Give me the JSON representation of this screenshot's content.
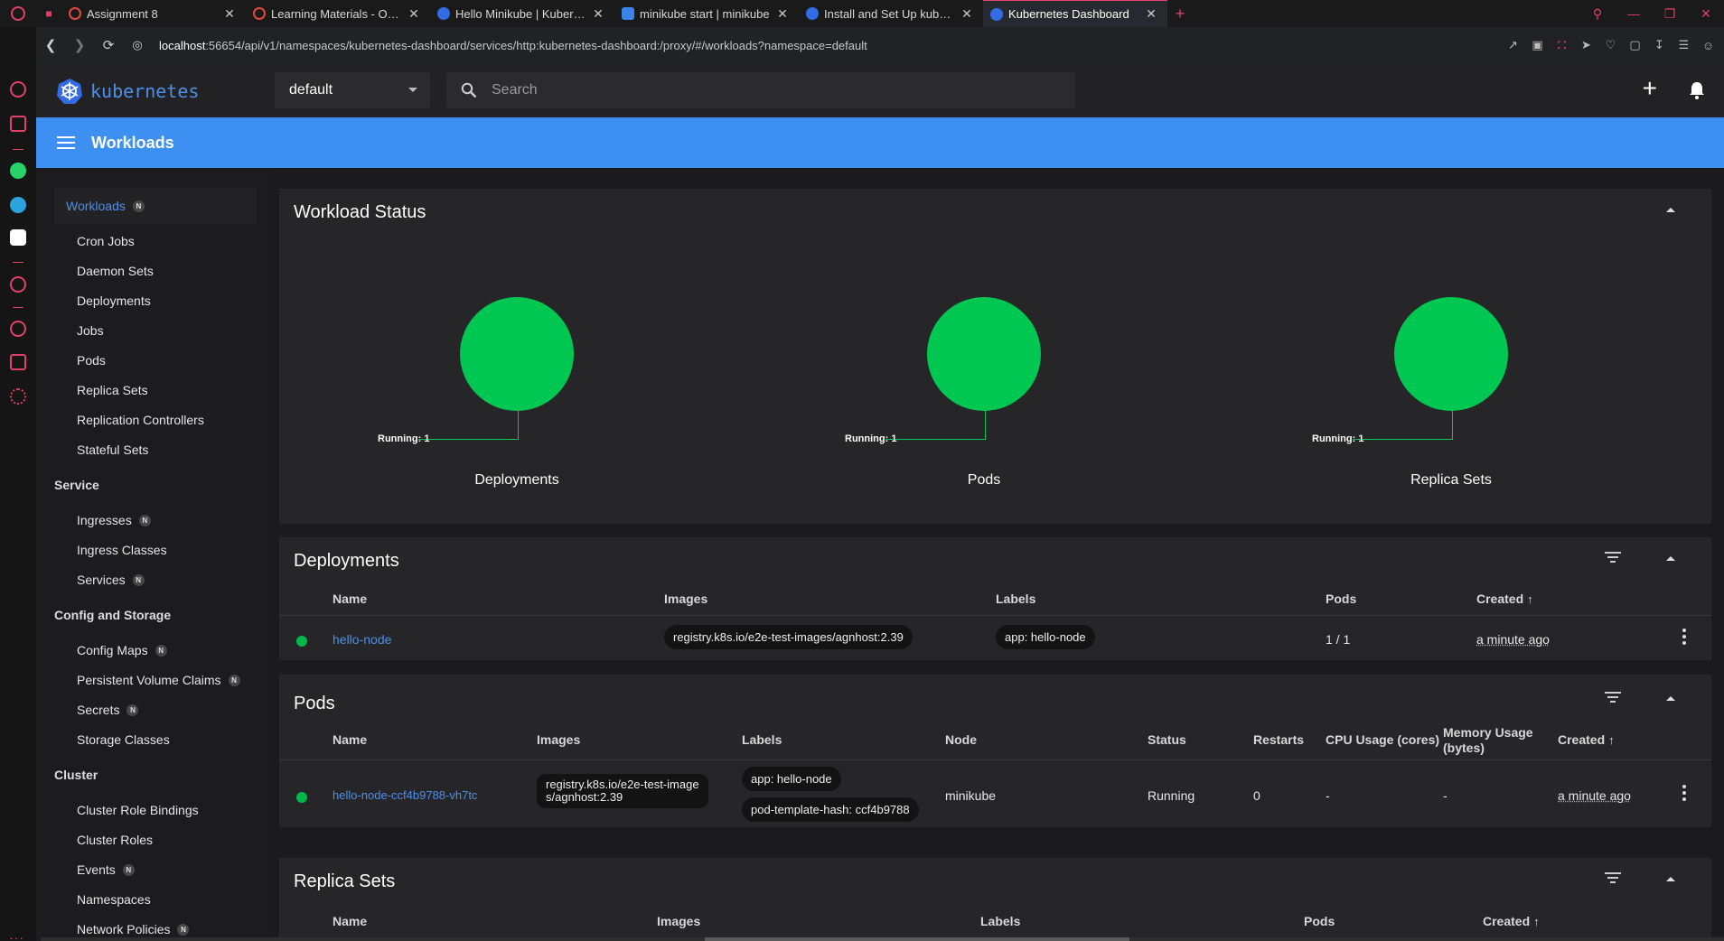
{
  "browser": {
    "tabs": [
      {
        "label": "",
        "favicon": "discord-icon",
        "color": "#e0406a"
      },
      {
        "label": "Assignment 8",
        "favicon": "red-ring",
        "color": "#e34b3b"
      },
      {
        "label": "Learning Materials - Opera",
        "favicon": "red-ring",
        "color": "#e34b3b"
      },
      {
        "label": "Hello Minikube | Kubernetes",
        "favicon": "k8s",
        "color": "#326ce5"
      },
      {
        "label": "minikube start | minikube",
        "favicon": "cube",
        "color": "#3a86e8"
      },
      {
        "label": "Install and Set Up kubectl on",
        "favicon": "k8s",
        "color": "#326ce5"
      },
      {
        "label": "Kubernetes Dashboard",
        "favicon": "k8s",
        "color": "#326ce5"
      }
    ],
    "url_host": "localhost",
    "url_rest": ":56654/api/v1/namespaces/kubernetes-dashboard/services/http:kubernetes-dashboard:/proxy/#/workloads?namespace=default"
  },
  "header": {
    "brand": "kubernetes",
    "namespace": "default",
    "search_placeholder": "Search"
  },
  "toolbar": {
    "title": "Workloads"
  },
  "nav": {
    "workloads": "Workloads",
    "workload_items": [
      "Cron Jobs",
      "Daemon Sets",
      "Deployments",
      "Jobs",
      "Pods",
      "Replica Sets",
      "Replication Controllers",
      "Stateful Sets"
    ],
    "service": "Service",
    "service_items": [
      "Ingresses",
      "Ingress Classes",
      "Services"
    ],
    "config": "Config and Storage",
    "config_items": [
      "Config Maps",
      "Persistent Volume Claims",
      "Secrets",
      "Storage Classes"
    ],
    "cluster": "Cluster",
    "cluster_items": [
      "Cluster Role Bindings",
      "Cluster Roles",
      "Events",
      "Namespaces",
      "Network Policies"
    ],
    "badge": "N"
  },
  "workload_status": {
    "title": "Workload Status",
    "cells": [
      {
        "name": "Deployments",
        "running_label": "Running: 1",
        "running": 1
      },
      {
        "name": "Pods",
        "running_label": "Running: 1",
        "running": 1
      },
      {
        "name": "Replica Sets",
        "running_label": "Running: 1",
        "running": 1
      }
    ],
    "running_color": "#00c752"
  },
  "deployments": {
    "title": "Deployments",
    "columns": [
      "Name",
      "Images",
      "Labels",
      "Pods",
      "Created"
    ],
    "row": {
      "name": "hello-node",
      "image": "registry.k8s.io/e2e-test-images/agnhost:2.39",
      "label": "app: hello-node",
      "pods": "1 / 1",
      "created": "a minute ago"
    }
  },
  "pods": {
    "title": "Pods",
    "columns": [
      "Name",
      "Images",
      "Labels",
      "Node",
      "Status",
      "Restarts",
      "CPU Usage (cores)",
      "Memory Usage",
      "(bytes)",
      "Created"
    ],
    "row": {
      "name": "hello-node-ccf4b9788-vh7tc",
      "image_line1": "registry.k8s.io/e2e-test-image",
      "image_line2": "s/agnhost:2.39",
      "label1": "app: hello-node",
      "label2": "pod-template-hash: ccf4b9788",
      "node": "minikube",
      "status": "Running",
      "restarts": "0",
      "cpu": "-",
      "memory": "-",
      "created": "a minute ago"
    }
  },
  "replica_sets": {
    "title": "Replica Sets",
    "columns": [
      "Name",
      "Images",
      "Labels",
      "Pods",
      "Created"
    ]
  },
  "colors": {
    "accent": "#3d8ff1",
    "link": "#4e8fe8",
    "ok": "#00c752",
    "opera": "#e0406a"
  }
}
